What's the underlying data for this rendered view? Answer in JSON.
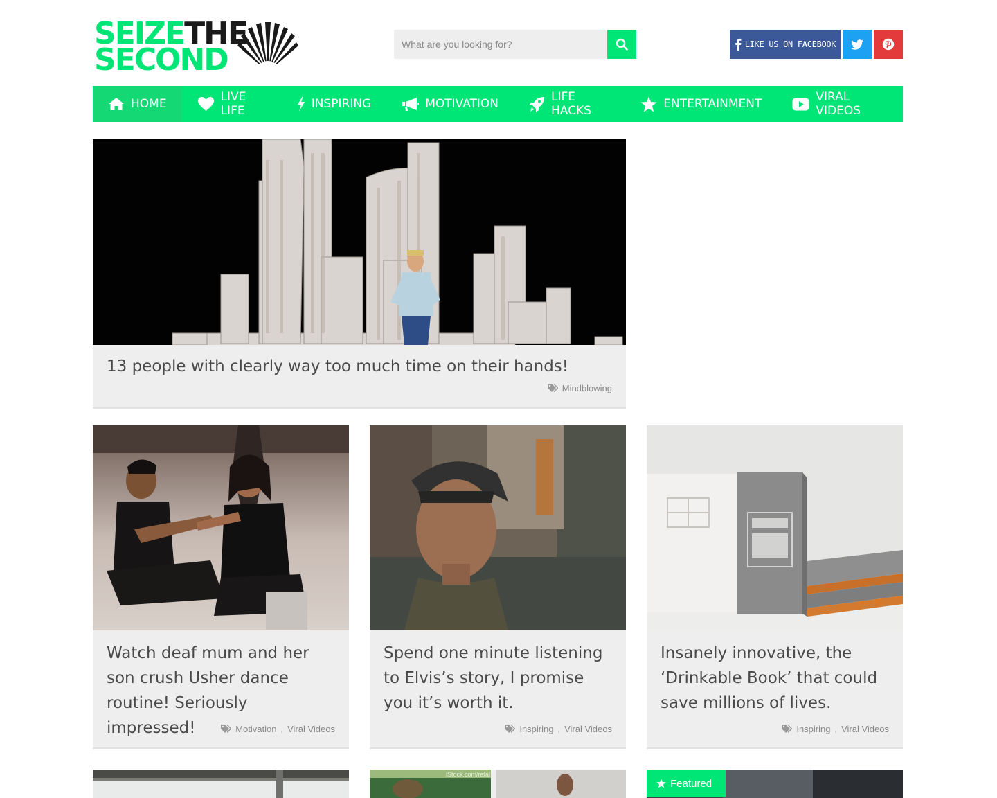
{
  "header": {
    "logo_line1": "SEIZE",
    "logo_line1_dark": "THE",
    "logo_line2": "SECOND",
    "logo_icon": "sunburst-icon",
    "search_placeholder": "What are you looking for?",
    "search_icon": "search-icon",
    "facebook_label": "LIKE US ON FACEBOOK",
    "twitter_icon": "twitter-icon",
    "pinterest_icon": "pinterest-icon"
  },
  "colors": {
    "brand_green": "#00e676",
    "nav_active": "#13d873",
    "facebook": "#3b5998",
    "twitter": "#1da1f2",
    "pinterest": "#e33b3b",
    "card_bg": "#eeeeee"
  },
  "nav": {
    "items": [
      {
        "label": "Home",
        "icon": "home-icon",
        "active": true
      },
      {
        "label": "Live Life",
        "icon": "heart-icon",
        "active": false
      },
      {
        "label": "Inspiring",
        "icon": "bolt-icon",
        "active": false
      },
      {
        "label": "Motivation",
        "icon": "megaphone-icon",
        "active": false
      },
      {
        "label": "Life Hacks",
        "icon": "rocket-icon",
        "active": false
      },
      {
        "label": "Entertainment",
        "icon": "star-icon",
        "active": false
      },
      {
        "label": "Viral Videos",
        "icon": "youtube-icon",
        "active": false
      }
    ]
  },
  "featured_post": {
    "title": "13 people with clearly way too much time on their hands!",
    "tags": [
      "Mindblowing"
    ]
  },
  "posts": [
    {
      "title": "Watch deaf mum and her son crush Usher dance routine! Seriously impressed!",
      "tags": [
        "Motivation",
        "Viral Videos"
      ]
    },
    {
      "title": "Spend one minute listening to Elvis’s story, I promise you it’s worth it.",
      "tags": [
        "Inspiring",
        "Viral Videos"
      ]
    },
    {
      "title": "Insanely innovative, the ‘Drinkable Book’ that could save millions of lives.",
      "tags": [
        "Inspiring",
        "Viral Videos"
      ]
    }
  ],
  "row3": {
    "featured_label": "Featured",
    "watermark": "iStock.com/rafal"
  }
}
